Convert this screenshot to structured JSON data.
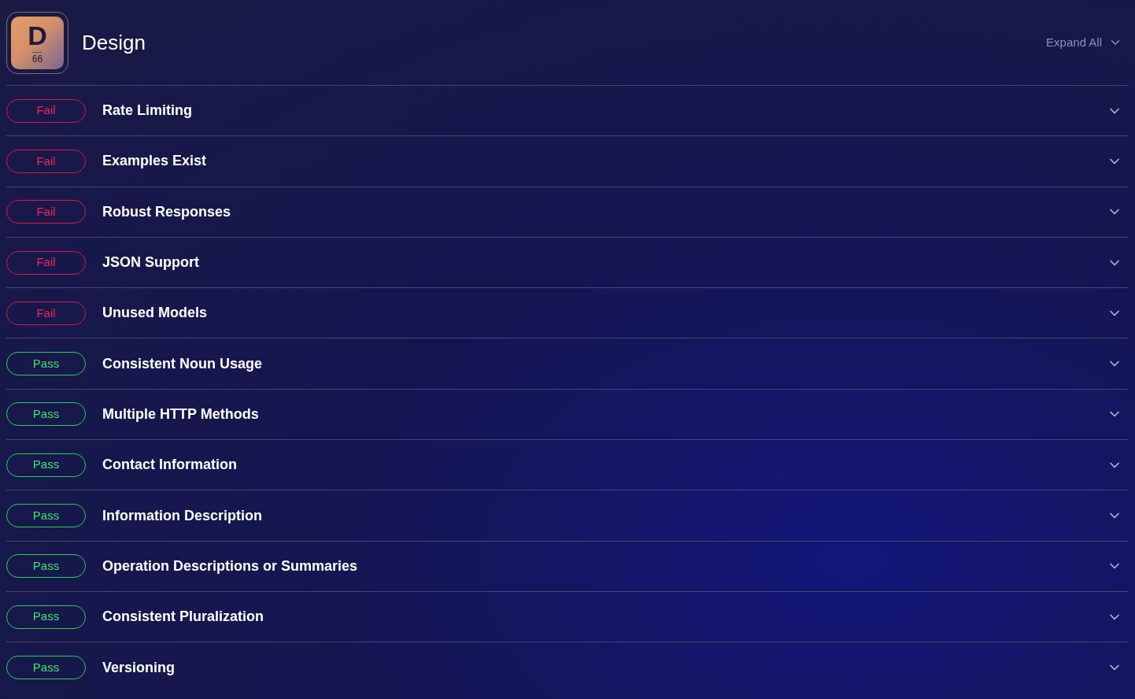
{
  "header": {
    "badge_letter": "D",
    "badge_score": "66",
    "title": "Design",
    "expand_all": "Expand All"
  },
  "checks": [
    {
      "kind": "fail",
      "label": "Fail",
      "title": "Rate Limiting"
    },
    {
      "kind": "fail",
      "label": "Fail",
      "title": "Examples Exist"
    },
    {
      "kind": "fail",
      "label": "Fail",
      "title": "Robust Responses"
    },
    {
      "kind": "fail",
      "label": "Fail",
      "title": "JSON Support"
    },
    {
      "kind": "fail",
      "label": "Fail",
      "title": "Unused Models"
    },
    {
      "kind": "pass",
      "label": "Pass",
      "title": "Consistent Noun Usage"
    },
    {
      "kind": "pass",
      "label": "Pass",
      "title": "Multiple HTTP Methods"
    },
    {
      "kind": "pass",
      "label": "Pass",
      "title": "Contact Information"
    },
    {
      "kind": "pass",
      "label": "Pass",
      "title": "Information Description"
    },
    {
      "kind": "pass",
      "label": "Pass",
      "title": "Operation Descriptions or Summaries"
    },
    {
      "kind": "pass",
      "label": "Pass",
      "title": "Consistent Pluralization"
    },
    {
      "kind": "pass",
      "label": "Pass",
      "title": "Versioning"
    }
  ]
}
